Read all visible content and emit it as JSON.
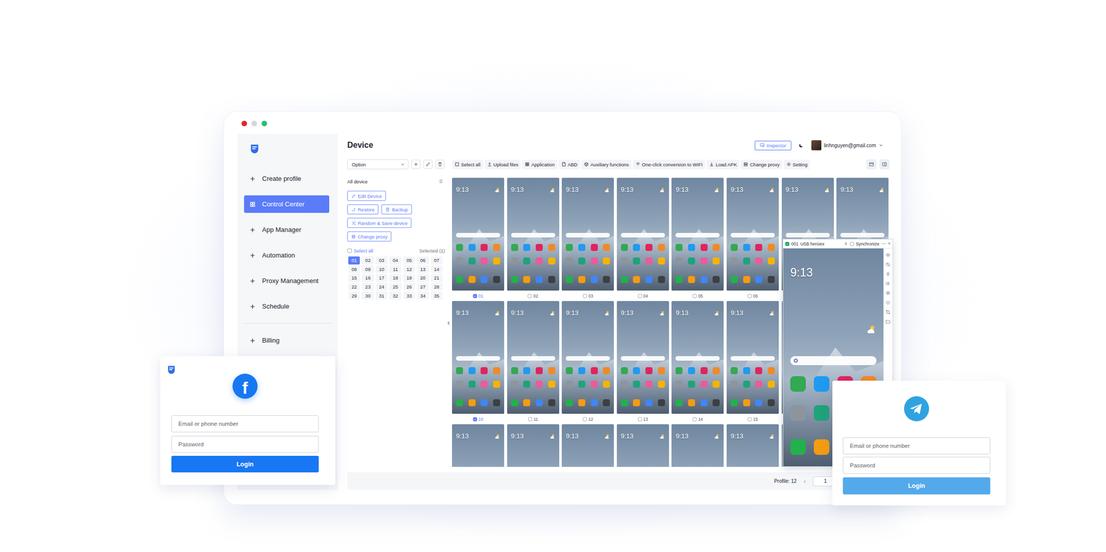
{
  "window": {
    "title": "Device"
  },
  "sidebar": {
    "items": [
      {
        "label": "Create profile",
        "selected": false
      },
      {
        "label": "Control Center",
        "selected": true
      },
      {
        "label": "App Manager",
        "selected": false
      },
      {
        "label": "Automation",
        "selected": false
      },
      {
        "label": "Proxy Management",
        "selected": false
      },
      {
        "label": "Schedule",
        "selected": false
      }
    ],
    "footer_items": [
      {
        "label": "Billing",
        "selected": false
      }
    ]
  },
  "header": {
    "inspector": "Inspector",
    "user": "linhnguyen@gmail.com"
  },
  "toolbar": {
    "select": "Option",
    "actions": [
      "Select all",
      "Upload files",
      "Application",
      "ABD",
      "Auxiliary functions",
      "One-click conversion to WIFI",
      "Load APK",
      "Change proxy",
      "Setting"
    ]
  },
  "panel": {
    "title": "All device",
    "button_rows": [
      [
        "Edit Device"
      ],
      [
        "Restore",
        "Backup"
      ],
      [
        "Random & Save device"
      ],
      [
        "Change proxy"
      ]
    ],
    "select_all": {
      "label": "Select all",
      "checked": false
    },
    "selected_count": "Selected (1)",
    "devices": [
      {
        "label": "01",
        "selected": true
      },
      {
        "label": "02",
        "selected": false
      },
      {
        "label": "03",
        "selected": false
      },
      {
        "label": "04",
        "selected": false
      },
      {
        "label": "05",
        "selected": false
      },
      {
        "label": "06",
        "selected": false
      },
      {
        "label": "07",
        "selected": false
      },
      {
        "label": "08",
        "selected": false
      },
      {
        "label": "09",
        "selected": false
      },
      {
        "label": "10",
        "selected": false
      },
      {
        "label": "11",
        "selected": false
      },
      {
        "label": "12",
        "selected": false
      },
      {
        "label": "13",
        "selected": false
      },
      {
        "label": "14",
        "selected": false
      },
      {
        "label": "15",
        "selected": false
      },
      {
        "label": "16",
        "selected": false
      },
      {
        "label": "17",
        "selected": false
      },
      {
        "label": "18",
        "selected": false
      },
      {
        "label": "19",
        "selected": false
      },
      {
        "label": "20",
        "selected": false
      },
      {
        "label": "21",
        "selected": false
      },
      {
        "label": "22",
        "selected": false
      },
      {
        "label": "23",
        "selected": false
      },
      {
        "label": "24",
        "selected": false
      },
      {
        "label": "25",
        "selected": false
      },
      {
        "label": "26",
        "selected": false
      },
      {
        "label": "27",
        "selected": false
      },
      {
        "label": "28",
        "selected": false
      },
      {
        "label": "29",
        "selected": false
      },
      {
        "label": "30",
        "selected": false
      },
      {
        "label": "31",
        "selected": false
      },
      {
        "label": "32",
        "selected": false
      },
      {
        "label": "33",
        "selected": false
      },
      {
        "label": "34",
        "selected": false
      },
      {
        "label": "35",
        "selected": false
      }
    ]
  },
  "collapse": "‹",
  "phones": {
    "rows": [
      [
        {
          "time": "9:13",
          "label": "01",
          "checked": true
        },
        {
          "time": "9:13",
          "label": "02",
          "checked": false
        },
        {
          "time": "9:13",
          "label": "03",
          "checked": false
        },
        {
          "time": "9:13",
          "label": "04",
          "checked": false
        },
        {
          "time": "9:13",
          "label": "05",
          "checked": false
        },
        {
          "time": "9:13",
          "label": "06",
          "checked": false
        },
        {
          "time": "9:13"
        },
        {
          "time": "9:13"
        }
      ],
      [
        {
          "time": "9:13",
          "label": "10",
          "checked": true
        },
        {
          "time": "9:13",
          "label": "11",
          "checked": false
        },
        {
          "time": "9:13",
          "label": "12",
          "checked": false
        },
        {
          "time": "9:13",
          "label": "13",
          "checked": false
        },
        {
          "time": "9:13",
          "label": "14",
          "checked": false
        },
        {
          "time": "9:13",
          "label": "15",
          "checked": false
        },
        {},
        {}
      ],
      [
        {
          "time": "9:13"
        },
        {
          "time": "9:13"
        },
        {
          "time": "9:13"
        },
        {
          "time": "9:13"
        },
        {
          "time": "9:13"
        },
        {
          "time": "9:13"
        },
        {},
        {}
      ]
    ]
  },
  "apps": [
    {
      "color": "#34a853"
    },
    {
      "color": "#1e9bf0"
    },
    {
      "color": "#e0245e"
    },
    {
      "color": "#f08a24"
    },
    {
      "color": "#8d949c"
    },
    {
      "color": "#1fa37a"
    },
    {
      "color": "#e85d9a"
    },
    {
      "color": "#f4b400"
    }
  ],
  "dock": [
    {
      "color": "#22b14c"
    },
    {
      "color": "#f39c12"
    },
    {
      "color": "#4285f4"
    },
    {
      "color": "#3c4043"
    }
  ],
  "device_window": {
    "checked": true,
    "id": "001",
    "title": "USB heroiex",
    "sync": {
      "label": "Synchronize",
      "checked": false
    },
    "minimize": "—",
    "close": "×",
    "time": "9:13"
  },
  "footer": {
    "count": "Profile: 12",
    "prev": "‹",
    "page": "1"
  },
  "facebook_login": {
    "logo": "f",
    "email": "Email or phone number",
    "password": "Password",
    "button": "Login"
  },
  "telegram_login": {
    "email": "Email or phone number",
    "password": "Password",
    "button": "Login"
  }
}
